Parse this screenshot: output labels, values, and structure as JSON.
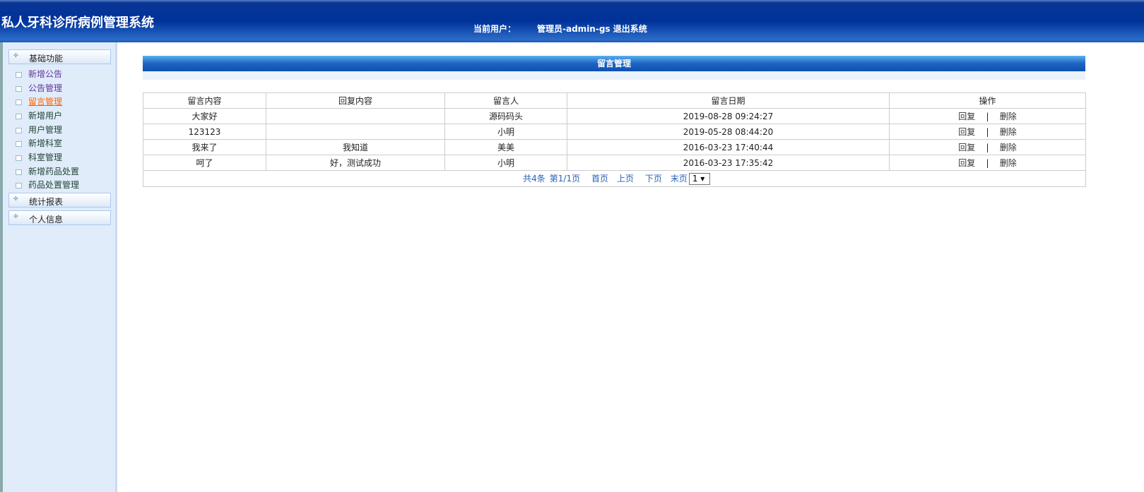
{
  "header": {
    "title": "私人牙科诊所病例管理系统",
    "user_label": "当前用户：",
    "user_name": "管理员-admin-gs",
    "logout": "退出系统"
  },
  "sidebar": {
    "groups": [
      "基础功能",
      "统计报表",
      "个人信息"
    ],
    "items": [
      "新增公告",
      "公告管理",
      "留言管理",
      "新增用户",
      "用户管理",
      "新增科室",
      "科室管理",
      "新增药品处置",
      "药品处置管理"
    ]
  },
  "main": {
    "title": "留言管理",
    "columns": [
      "留言内容",
      "回复内容",
      "留言人",
      "留言日期",
      "操作"
    ],
    "rows": [
      [
        "大家好",
        "",
        "源码码头",
        "2019-08-28 09:24:27"
      ],
      [
        "123123",
        "",
        "小明",
        "2019-05-28 08:44:20"
      ],
      [
        "我来了",
        "我知道",
        "美美",
        "2016-03-23 17:40:44"
      ],
      [
        "呵了",
        "好，测试成功",
        "小明",
        "2016-03-23 17:35:42"
      ]
    ],
    "actions": {
      "reply": "回复",
      "sep": "|",
      "delete": "删除"
    },
    "pager": {
      "total": "共4条",
      "page": "第1/1页",
      "first": "首页",
      "prev": "上页",
      "next": "下页",
      "last": "末页",
      "select": "1 ▾"
    }
  }
}
